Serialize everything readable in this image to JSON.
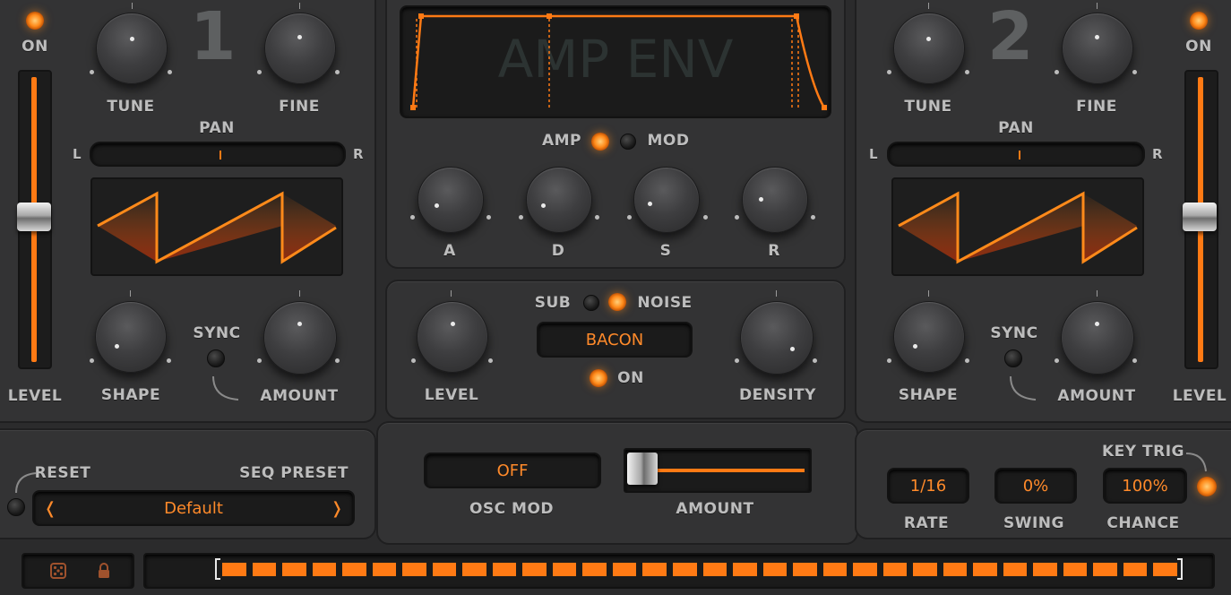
{
  "osc1": {
    "on_label": "ON",
    "number": "1",
    "tune_label": "TUNE",
    "fine_label": "FINE",
    "pan_label": "PAN",
    "pan_left": "L",
    "pan_right": "R",
    "shape_label": "SHAPE",
    "sync_label": "SYNC",
    "amount_label": "AMOUNT",
    "level_label": "LEVEL"
  },
  "osc2": {
    "on_label": "ON",
    "number": "2",
    "tune_label": "TUNE",
    "fine_label": "FINE",
    "pan_label": "PAN",
    "pan_left": "L",
    "pan_right": "R",
    "shape_label": "SHAPE",
    "sync_label": "SYNC",
    "amount_label": "AMOUNT",
    "level_label": "LEVEL"
  },
  "envelope": {
    "display_title": "AMP ENV",
    "amp_label": "AMP",
    "mod_label": "MOD",
    "a_label": "A",
    "d_label": "D",
    "s_label": "S",
    "r_label": "R"
  },
  "noise": {
    "sub_label": "SUB",
    "noise_label": "NOISE",
    "preset_value": "BACON",
    "on_label": "ON",
    "level_label": "LEVEL",
    "density_label": "DENSITY"
  },
  "sequencer": {
    "reset_label": "RESET",
    "seq_preset_label": "SEQ PRESET",
    "preset_value": "Default",
    "prev_arrow": "❬",
    "next_arrow": "❭",
    "osc_mod_value": "OFF",
    "osc_mod_label": "OSC MOD",
    "amount_label": "AMOUNT",
    "key_trig_label": "KEY TRIG",
    "rate_value": "1/16",
    "rate_label": "RATE",
    "swing_value": "0%",
    "swing_label": "SWING",
    "chance_value": "100%",
    "chance_label": "CHANCE",
    "step_count": 32
  },
  "colors": {
    "accent": "#ff7a14",
    "panel": "#333334",
    "background": "#2b2b2c"
  }
}
